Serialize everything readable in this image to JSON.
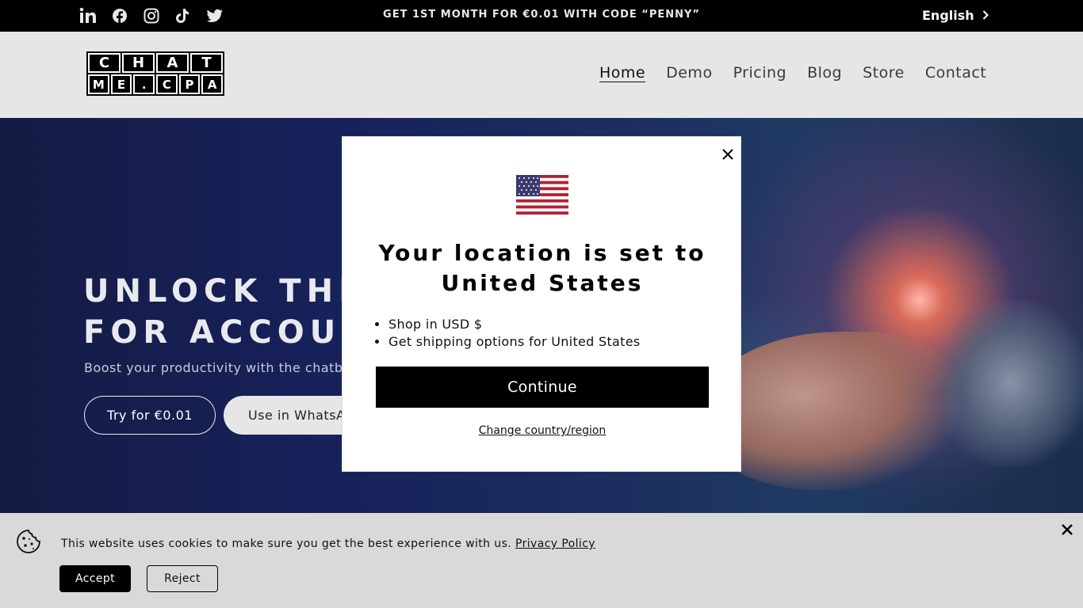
{
  "topbar": {
    "social_icons": [
      "linkedin-icon",
      "facebook-icon",
      "instagram-icon",
      "tiktok-icon",
      "twitter-icon"
    ],
    "announcement": "GET 1ST MONTH FOR €0.01 WITH CODE “PENNY”",
    "language": "English"
  },
  "header": {
    "logo_line1": [
      "C",
      "H",
      "A",
      "T"
    ],
    "logo_line2": [
      "M",
      "E",
      ".",
      "C",
      "P",
      "A"
    ],
    "nav": [
      "Home",
      "Demo",
      "Pricing",
      "Blog",
      "Store",
      "Contact"
    ],
    "active_nav": "Home"
  },
  "hero": {
    "title_line1": "UNLOCK THE P",
    "title_line2": "FOR ACCOUNT",
    "subtitle": "Boost your productivity with the chatbot",
    "try_button": "Try for €0.01",
    "whatsapp_button": "Use in WhatsAp"
  },
  "modal": {
    "title_line1": "Your location is set to",
    "title_line2": "United States",
    "bullets": [
      "Shop in USD $",
      "Get shipping options for United States"
    ],
    "continue_button": "Continue",
    "change_link": "Change country/region"
  },
  "cookie": {
    "text": "This website uses cookies to make sure you get the best experience with us.",
    "privacy_link": "Privacy Policy",
    "accept": "Accept",
    "reject": "Reject"
  },
  "colors": {
    "topbar_bg": "#000000",
    "header_bg": "#e6e6e6",
    "hero_bg": "#17215a",
    "modal_bg": "#ffffff",
    "primary_button": "#000000",
    "cookie_bg": "#d9d9d9"
  }
}
